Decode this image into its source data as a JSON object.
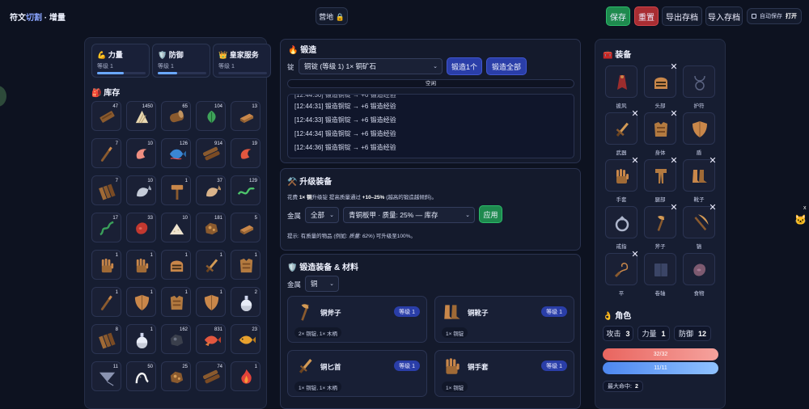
{
  "header": {
    "brand_a": "符文",
    "brand_b": "切割",
    "brand_c": "· 增量",
    "camp_label": "营地 🔒",
    "save": "保存",
    "reset": "重置",
    "export": "导出存档",
    "import": "导入存档",
    "autosave": "自动保存",
    "autosave_state": "打开"
  },
  "skills": [
    {
      "icon": "💪",
      "name": "力量",
      "level": "等级 1",
      "progress": 0.55
    },
    {
      "icon": "🛡️",
      "name": "防御",
      "level": "等级 1",
      "progress": 0.4
    },
    {
      "icon": "👑",
      "name": "皇家服务",
      "level": "等级 1",
      "progress": 0.0
    }
  ],
  "inventory": {
    "title": "库存",
    "icon": "🎒",
    "items": [
      {
        "icon": "plank",
        "count": "47"
      },
      {
        "icon": "scroll",
        "count": "1450"
      },
      {
        "icon": "log",
        "count": "65"
      },
      {
        "icon": "herb",
        "count": "104"
      },
      {
        "icon": "bar",
        "count": "13"
      },
      {
        "icon": "stick",
        "count": "7"
      },
      {
        "icon": "shrimp",
        "count": "10"
      },
      {
        "icon": "fish-blue",
        "count": "126"
      },
      {
        "icon": "logs",
        "count": "914"
      },
      {
        "icon": "shrimp-red",
        "count": "19"
      },
      {
        "icon": "planks",
        "count": "7"
      },
      {
        "icon": "fish-grey",
        "count": "10"
      },
      {
        "icon": "hammer",
        "count": "1"
      },
      {
        "icon": "fish-tan",
        "count": "37"
      },
      {
        "icon": "eel",
        "count": "129"
      },
      {
        "icon": "eel-green",
        "count": "17"
      },
      {
        "icon": "meat",
        "count": "33"
      },
      {
        "icon": "flour",
        "count": "10"
      },
      {
        "icon": "ore",
        "count": "181"
      },
      {
        "icon": "bar",
        "count": "5"
      },
      {
        "icon": "gauntlet",
        "count": "1"
      },
      {
        "icon": "gauntlet",
        "count": "1"
      },
      {
        "icon": "helm",
        "count": "1"
      },
      {
        "icon": "sword",
        "count": "1"
      },
      {
        "icon": "armor",
        "count": "1"
      },
      {
        "icon": "stick",
        "count": "1"
      },
      {
        "icon": "shield",
        "count": "1"
      },
      {
        "icon": "armor",
        "count": "1"
      },
      {
        "icon": "shield",
        "count": "1"
      },
      {
        "icon": "potion",
        "count": "2"
      },
      {
        "icon": "planks",
        "count": "8"
      },
      {
        "icon": "potion",
        "count": "1"
      },
      {
        "icon": "ore-dark",
        "count": "162"
      },
      {
        "icon": "fish-orange",
        "count": "831"
      },
      {
        "icon": "fish-yellow",
        "count": "23"
      },
      {
        "icon": "ray",
        "count": "11"
      },
      {
        "icon": "tentacle",
        "count": "50"
      },
      {
        "icon": "ore",
        "count": "25"
      },
      {
        "icon": "logs",
        "count": "74"
      },
      {
        "icon": "fire",
        "count": "1"
      }
    ]
  },
  "forge": {
    "icon": "🔥",
    "title": "锻造",
    "ingot_label": "锭",
    "ingot_value": "铜锭 (等级 1) 1× 铜矿石",
    "forge_one": "锻造1个",
    "forge_all": "锻造全部",
    "status": "空闲",
    "log": [
      "[12:44:30] 锻造铜锭 → +6 锻造经验",
      "[12:44:31] 锻造铜锭 → +6 锻造经验",
      "[12:44:33] 锻造铜锭 → +6 锻造经验",
      "[12:44:34] 锻造铜锭 → +6 锻造经验",
      "[12:44:36] 锻造铜锭 → +6 锻造经验"
    ]
  },
  "upgrade": {
    "icon": "⚒️",
    "title": "升级装备",
    "desc_a": "花费 ",
    "desc_b": "1× 铜",
    "desc_c": "升级锭 提高质量通过 ",
    "desc_d": "+10–25%",
    "desc_e": " (越高的锻造越倾斜)。",
    "metal_label": "金属",
    "metal_value": "全部",
    "item_value": "青铜板甲 · 质量: 25% — 库存",
    "apply": "应用",
    "hint_a": "提示: 有质量的物品 (例如: ",
    "hint_b": "质量: 62%",
    "hint_c": ") 可升级至100%。"
  },
  "smithing": {
    "icon": "🛡️",
    "title": "锻造装备 & 材料",
    "metal_label": "金属",
    "metal_value": "铜",
    "cards": [
      {
        "icon": "axe",
        "name": "铜斧子",
        "level": "等级 1",
        "mats": "2× 铜锭, 1× 木柄"
      },
      {
        "icon": "boots",
        "name": "铜靴子",
        "level": "等级 1",
        "mats": "1× 铜锭"
      },
      {
        "icon": "dagger",
        "name": "铜匕首",
        "level": "等级 1",
        "mats": "1× 铜锭, 1× 木柄"
      },
      {
        "icon": "gauntlet",
        "name": "铜手套",
        "level": "等级 1",
        "mats": "1× 铜锭"
      }
    ]
  },
  "equipment": {
    "icon": "🧰",
    "title": "装备",
    "slots": [
      {
        "icon": "cape",
        "label": "披风",
        "removable": false
      },
      {
        "icon": "helm",
        "label": "头部",
        "removable": true
      },
      {
        "icon": "amulet",
        "label": "护符",
        "removable": false
      },
      {
        "icon": "sword",
        "label": "武器",
        "removable": true
      },
      {
        "icon": "armor",
        "label": "身体",
        "removable": true
      },
      {
        "icon": "shield",
        "label": "盾",
        "removable": false
      },
      {
        "icon": "gauntlet",
        "label": "手套",
        "removable": true
      },
      {
        "icon": "legs",
        "label": "腿部",
        "removable": true
      },
      {
        "icon": "boots",
        "label": "靴子",
        "removable": true
      },
      {
        "icon": "ring",
        "label": "戒指",
        "removable": false
      },
      {
        "icon": "axe",
        "label": "斧子",
        "removable": true
      },
      {
        "icon": "pickaxe",
        "label": "镐",
        "removable": true
      },
      {
        "icon": "whip",
        "label": "平",
        "removable": true
      },
      {
        "icon": "book",
        "label": "卷轴",
        "removable": false
      },
      {
        "icon": "meat-dark",
        "label": "食物",
        "removable": false
      }
    ]
  },
  "character": {
    "icon": "👌",
    "title": "角色",
    "attack_label": "攻击",
    "attack": "3",
    "strength_label": "力量",
    "strength": "1",
    "defense_label": "防御",
    "defense": "12",
    "hp": "32/32",
    "mp": "11/11",
    "maxhit_label": "最大命中:",
    "maxhit": "2"
  },
  "colors": {
    "accent": "#2a3ea8",
    "save": "#1e8a4e",
    "reset": "#a82d32",
    "hp": "#f08a86",
    "mp": "#6fa8ff"
  }
}
